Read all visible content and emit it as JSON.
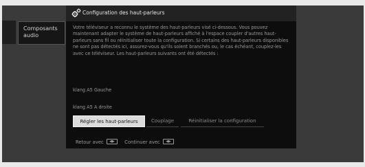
{
  "sidebar": {
    "item_label_line1": "Composants",
    "item_label_line2": "audio"
  },
  "dialog": {
    "title": "Configuration des haut-parleurs",
    "icon": "gears-icon",
    "body": "Votre téléviseur a reconnu le système des haut-parleurs visé ci-dessous. Vous pouvez maintenant adapter le système de haut-parleurs affiché à l'espace coupler d'autres haut-parleurs sans fil ou réinitialiser toute la configuration. Si certains des haut-parleurs disponibles ne sont pas détectés ici, assurez-vous qu'ils soient branchés ou, le cas échéant, couplez-les avec ce téléviseur. Les haut-parleurs suivants ont été détectés :",
    "speakers": [
      "klang A5 Gauche",
      "klang A5 A droite"
    ],
    "actions": {
      "primary": "Régler les haut-parleurs",
      "couplage": "Couplage",
      "reset": "Réinitialiser la configuration"
    },
    "footer": {
      "back": "Retour avec",
      "continue": "Continuer avec",
      "key_icon": "remote-key-icon"
    }
  },
  "colors": {
    "dialog_bg": "#0d0d0d",
    "header_bg": "#222222",
    "selected_button_bg": "#dcdcdc",
    "text": "#9a9a9a"
  }
}
